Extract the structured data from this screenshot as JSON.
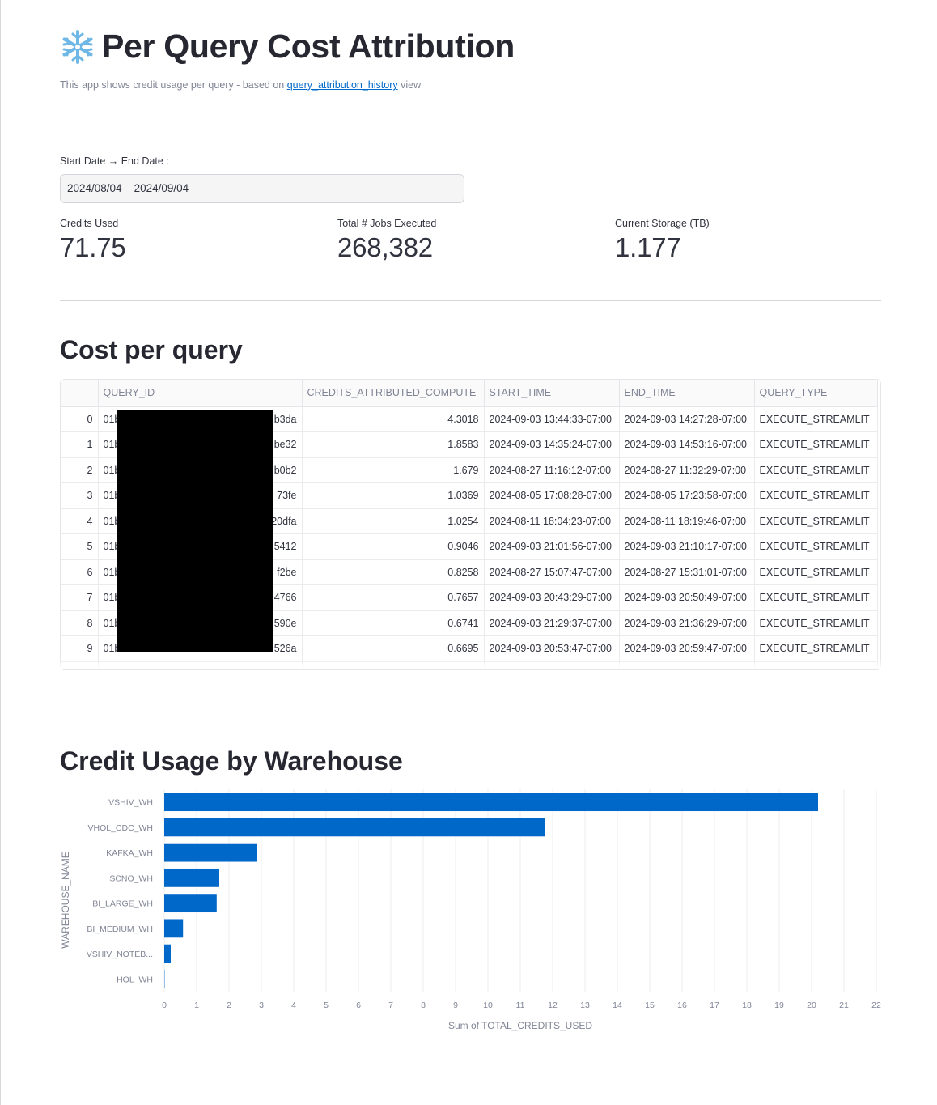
{
  "header": {
    "title": "Per Query Cost Attribution",
    "icon": "snowflake-icon",
    "caption_prefix": "This app shows credit usage per query - based on",
    "caption_link": "query_attribution_history",
    "caption_suffix": "view"
  },
  "date_range": {
    "label": "Start Date → End Date :",
    "value": "2024/08/04 – 2024/09/04"
  },
  "metrics": [
    {
      "label": "Credits Used",
      "value": "71.75"
    },
    {
      "label": "Total # Jobs Executed",
      "value": "268,382"
    },
    {
      "label": "Current Storage (TB)",
      "value": "1.177"
    }
  ],
  "cost_table": {
    "title": "Cost per query",
    "columns": [
      "",
      "QUERY_ID",
      "CREDITS_ATTRIBUTED_COMPUTE",
      "START_TIME",
      "END_TIME",
      "QUERY_TYPE"
    ],
    "rows": [
      {
        "index": "0",
        "query_start": "01b",
        "query_end": "b3da",
        "credits": "4.3018",
        "start": "2024-09-03 13:44:33-07:00",
        "end": "2024-09-03 14:27:28-07:00",
        "type": "EXECUTE_STREAMLIT"
      },
      {
        "index": "1",
        "query_start": "01b",
        "query_end": "be32",
        "credits": "1.8583",
        "start": "2024-09-03 14:35:24-07:00",
        "end": "2024-09-03 14:53:16-07:00",
        "type": "EXECUTE_STREAMLIT"
      },
      {
        "index": "2",
        "query_start": "01b",
        "query_end": "b0b2",
        "credits": "1.679",
        "start": "2024-08-27 11:16:12-07:00",
        "end": "2024-08-27 11:32:29-07:00",
        "type": "EXECUTE_STREAMLIT"
      },
      {
        "index": "3",
        "query_start": "01b",
        "query_end": "73fe",
        "credits": "1.0369",
        "start": "2024-08-05 17:08:28-07:00",
        "end": "2024-08-05 17:23:58-07:00",
        "type": "EXECUTE_STREAMLIT"
      },
      {
        "index": "4",
        "query_start": "01b",
        "query_end": "20dfa",
        "credits": "1.0254",
        "start": "2024-08-11 18:04:23-07:00",
        "end": "2024-08-11 18:19:46-07:00",
        "type": "EXECUTE_STREAMLIT"
      },
      {
        "index": "5",
        "query_start": "01b",
        "query_end": "5412",
        "credits": "0.9046",
        "start": "2024-09-03 21:01:56-07:00",
        "end": "2024-09-03 21:10:17-07:00",
        "type": "EXECUTE_STREAMLIT"
      },
      {
        "index": "6",
        "query_start": "01b",
        "query_end": "f2be",
        "credits": "0.8258",
        "start": "2024-08-27 15:07:47-07:00",
        "end": "2024-08-27 15:31:01-07:00",
        "type": "EXECUTE_STREAMLIT"
      },
      {
        "index": "7",
        "query_start": "01b",
        "query_end": "4766",
        "credits": "0.7657",
        "start": "2024-09-03 20:43:29-07:00",
        "end": "2024-09-03 20:50:49-07:00",
        "type": "EXECUTE_STREAMLIT"
      },
      {
        "index": "8",
        "query_start": "01b",
        "query_end": "590e",
        "credits": "0.6741",
        "start": "2024-09-03 21:29:37-07:00",
        "end": "2024-09-03 21:36:29-07:00",
        "type": "EXECUTE_STREAMLIT"
      },
      {
        "index": "9",
        "query_start": "01b",
        "query_end": "526a",
        "credits": "0.6695",
        "start": "2024-09-03 20:53:47-07:00",
        "end": "2024-09-03 20:59:47-07:00",
        "type": "EXECUTE_STREAMLIT"
      }
    ]
  },
  "warehouse_section": {
    "title": "Credit Usage by Warehouse"
  },
  "chart_data": {
    "type": "bar",
    "orientation": "horizontal",
    "categories": [
      "VSHIV_WH",
      "VHOL_CDC_WH",
      "KAFKA_WH",
      "SCNO_WH",
      "BI_LARGE_WH",
      "BI_MEDIUM_WH",
      "VSHIV_NOTEB...",
      "HOL_WH"
    ],
    "values": [
      20.2,
      11.75,
      2.85,
      1.7,
      1.62,
      0.58,
      0.2,
      0.01
    ],
    "xlabel": "Sum of TOTAL_CREDITS_USED",
    "ylabel": "WAREHOUSE_NAME",
    "xlim": [
      0,
      22
    ],
    "xticks": [
      0,
      1,
      2,
      3,
      4,
      5,
      6,
      7,
      8,
      9,
      10,
      11,
      12,
      13,
      14,
      15,
      16,
      17,
      18,
      19,
      20,
      21,
      22
    ],
    "grid": true,
    "bar_color": "#0068c9"
  },
  "colors": {
    "text": "#31333f",
    "muted": "#808495",
    "link": "#0068c9",
    "bar": "#0068c9"
  }
}
